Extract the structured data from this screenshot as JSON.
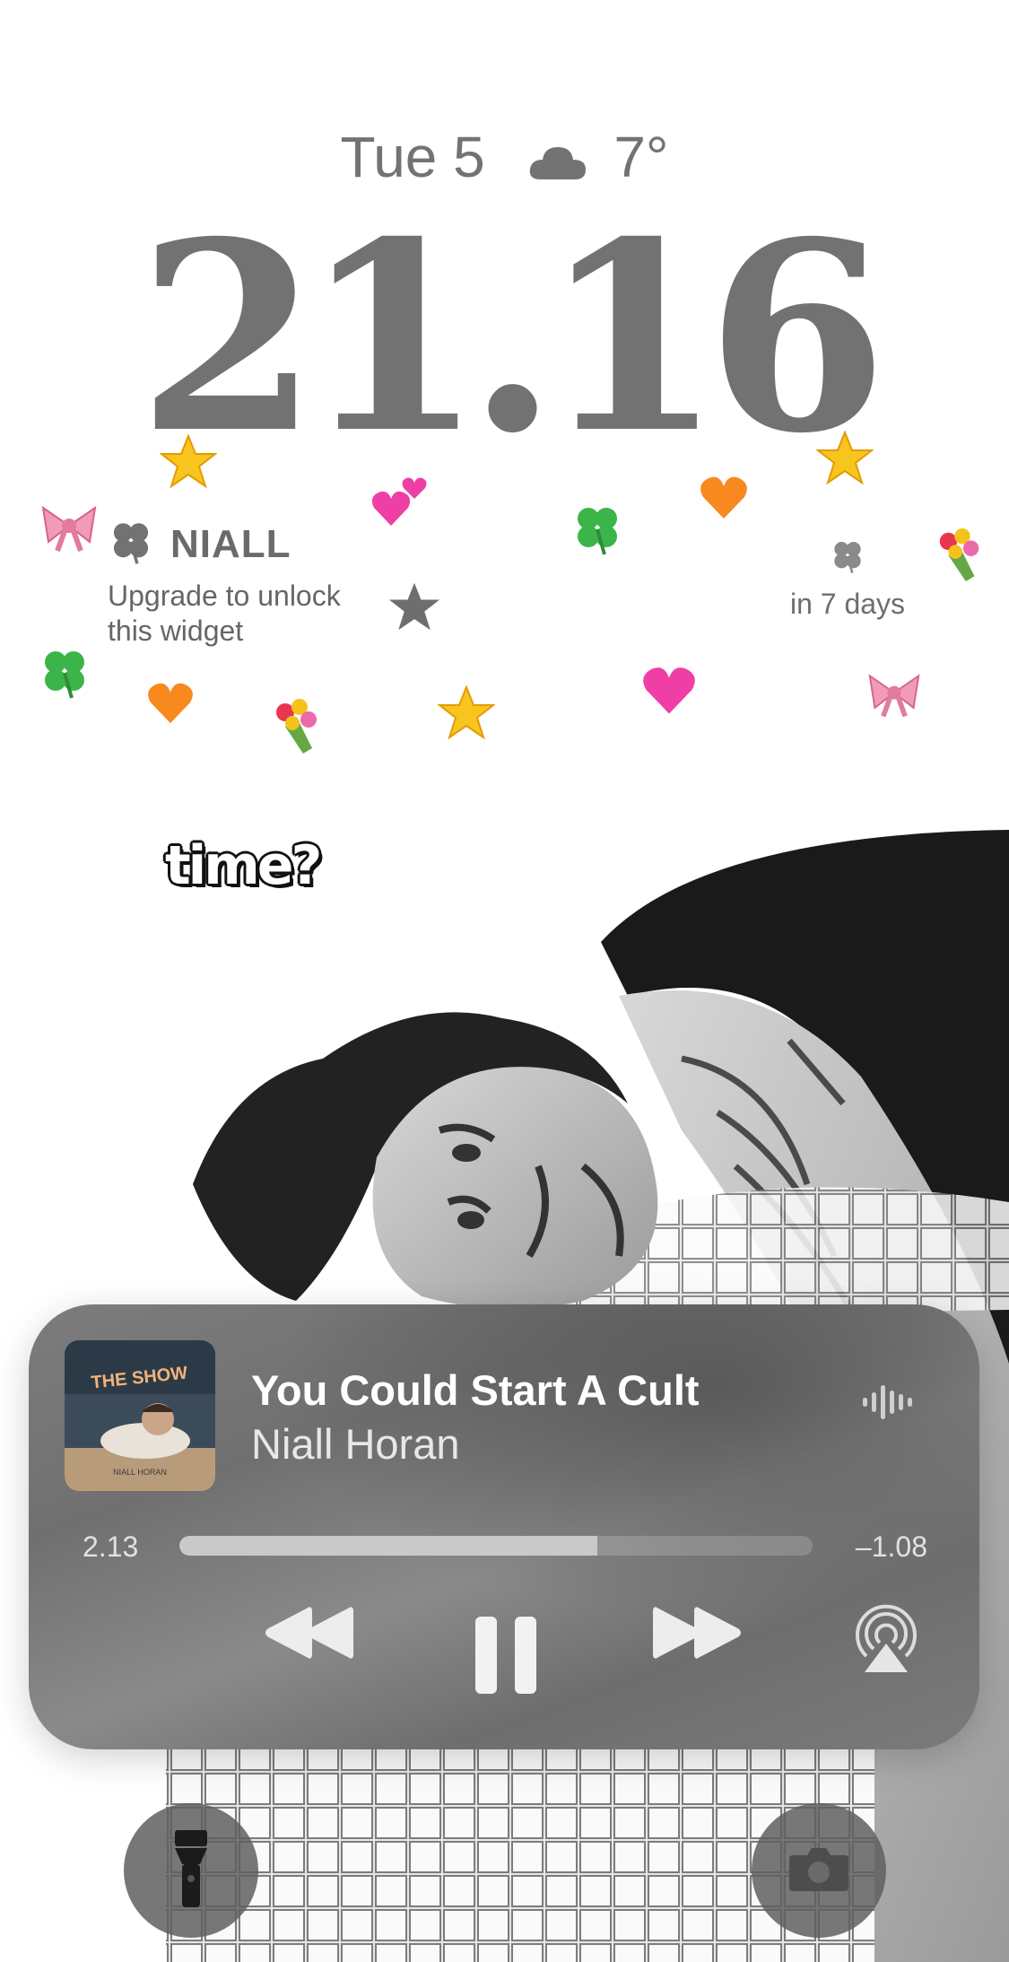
{
  "lockscreen": {
    "date": "Tue 5",
    "weather_icon": "cloud-icon",
    "temperature": "7°",
    "time": "21.16"
  },
  "widgets": {
    "left": {
      "icon": "clover-icon",
      "title": "NIALL",
      "message_line1": "Upgrade to unlock",
      "message_line2": "this widget"
    },
    "right": {
      "icon": "clover-icon",
      "countdown": "in 7 days"
    }
  },
  "sticker_text": "time?",
  "album_art_text": "THE SHOW",
  "album_art_subtext": "NIALL HORAN",
  "now_playing": {
    "title": "You Could Start A Cult",
    "artist": "Niall Horan",
    "elapsed": "2.13",
    "remaining": "–1.08",
    "progress_fraction": 0.66
  },
  "controls": {
    "rewind": "rewind-icon",
    "pause": "pause-icon",
    "forward": "fast-forward-icon",
    "airplay": "airplay-icon"
  },
  "quick_actions": {
    "left": "flashlight-icon",
    "right": "camera-icon"
  },
  "colors": {
    "clock": "#727272",
    "card": "#7a7a7a",
    "progress_fill": "#c9c9c9"
  }
}
